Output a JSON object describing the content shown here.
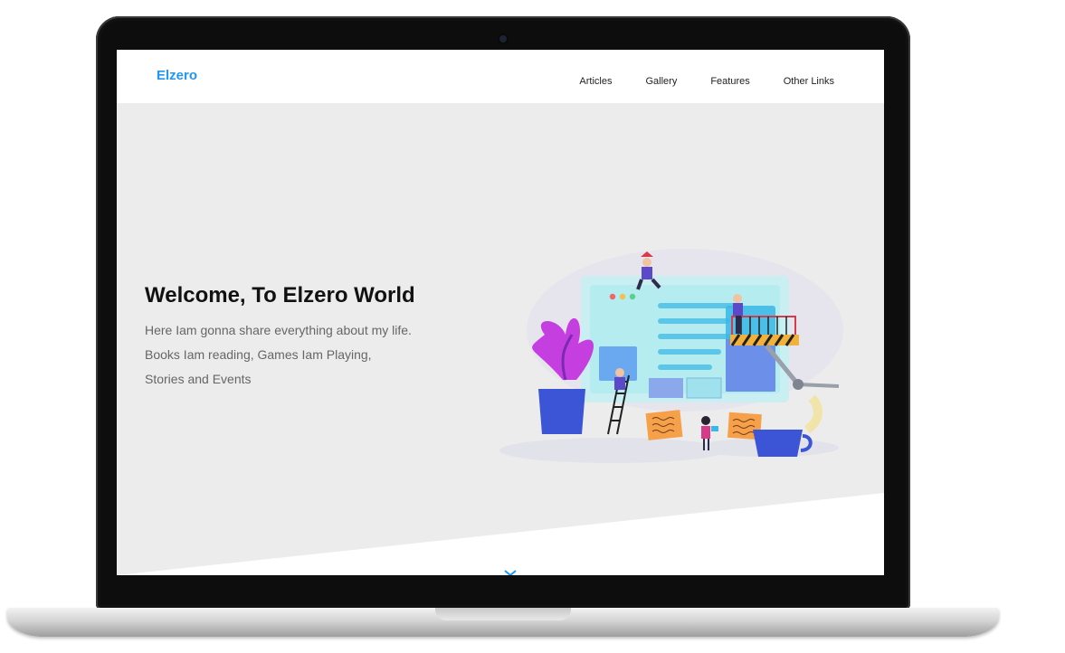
{
  "site": {
    "logo": "Elzero",
    "accent_color": "#2196f3"
  },
  "nav": {
    "items": [
      {
        "label": "Articles"
      },
      {
        "label": "Gallery"
      },
      {
        "label": "Features"
      },
      {
        "label": "Other Links"
      }
    ]
  },
  "hero": {
    "title": "Welcome, To Elzero World",
    "lines": [
      "Here Iam gonna share everything about my life.",
      "Books Iam reading, Games Iam Playing,",
      "Stories and Events"
    ],
    "illustration_icon": "website-building-illustration"
  }
}
